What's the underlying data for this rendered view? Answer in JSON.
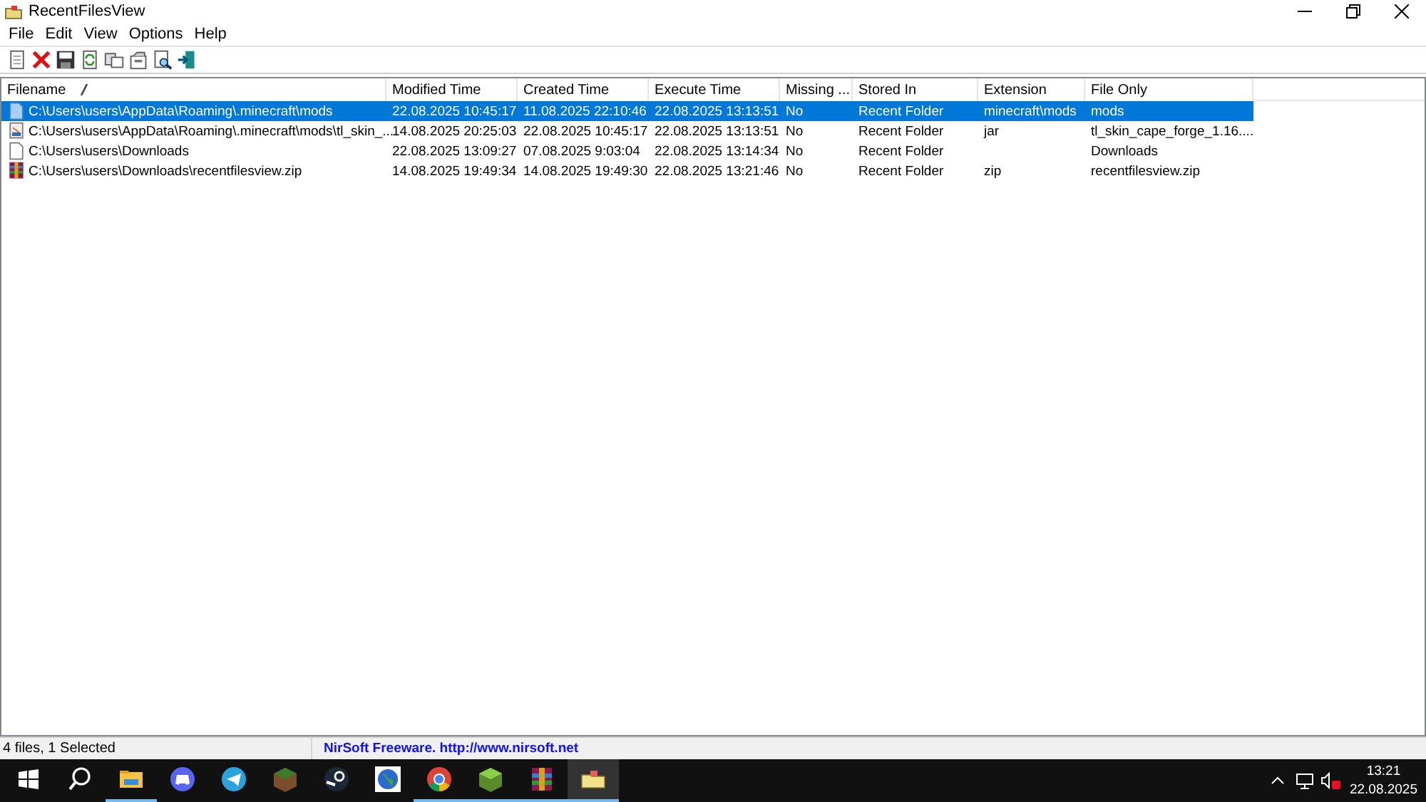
{
  "window": {
    "title": "RecentFilesView"
  },
  "menu": [
    "File",
    "Edit",
    "View",
    "Options",
    "Help"
  ],
  "table": {
    "columns": [
      {
        "label": "Filename",
        "sorted": true
      },
      {
        "label": "Modified Time",
        "sorted": false
      },
      {
        "label": "Created Time",
        "sorted": false
      },
      {
        "label": "Execute Time",
        "sorted": false
      },
      {
        "label": "Missing ...",
        "sorted": false
      },
      {
        "label": "Stored In",
        "sorted": false
      },
      {
        "label": "Extension",
        "sorted": false
      },
      {
        "label": "File Only",
        "sorted": false
      }
    ],
    "rows": [
      {
        "kind": "folder",
        "selected": true,
        "cells": [
          "C:\\Users\\users\\AppData\\Roaming\\.minecraft\\mods",
          "22.08.2025 10:45:17",
          "11.08.2025 22:10:46",
          "22.08.2025 13:13:51",
          "No",
          "Recent Folder",
          "minecraft\\mods",
          "mods"
        ]
      },
      {
        "kind": "jar",
        "selected": false,
        "cells": [
          "C:\\Users\\users\\AppData\\Roaming\\.minecraft\\mods\\tl_skin_...",
          "14.08.2025 20:25:03",
          "22.08.2025 10:45:17",
          "22.08.2025 13:13:51",
          "No",
          "Recent Folder",
          "jar",
          "tl_skin_cape_forge_1.16...."
        ]
      },
      {
        "kind": "file",
        "selected": false,
        "cells": [
          "C:\\Users\\users\\Downloads",
          "22.08.2025 13:09:27",
          "07.08.2025 9:03:04",
          "22.08.2025 13:14:34",
          "No",
          "Recent Folder",
          "",
          "Downloads"
        ]
      },
      {
        "kind": "archive",
        "selected": false,
        "cells": [
          "C:\\Users\\users\\Downloads\\recentfilesview.zip",
          "14.08.2025 19:49:34",
          "14.08.2025 19:49:30",
          "22.08.2025 13:21:46",
          "No",
          "Recent Folder",
          "zip",
          "recentfilesview.zip"
        ]
      }
    ]
  },
  "status_bar": {
    "summary": "4 files, 1 Selected",
    "credit": "NirSoft Freeware.  http://www.nirsoft.net"
  },
  "taskbar": {
    "apps": [
      {
        "kind": "explorer",
        "running": true,
        "active": false
      },
      {
        "kind": "discord",
        "running": false,
        "active": false
      },
      {
        "kind": "telegram",
        "running": false,
        "active": false
      },
      {
        "kind": "dirt",
        "running": false,
        "active": false
      },
      {
        "kind": "steam",
        "running": false,
        "active": false
      },
      {
        "kind": "globe",
        "running": false,
        "active": false
      },
      {
        "kind": "chrome",
        "running": true,
        "active": false
      },
      {
        "kind": "grass",
        "running": true,
        "active": false
      },
      {
        "kind": "winrar",
        "running": true,
        "active": false
      },
      {
        "kind": "appfolder",
        "running": true,
        "active": true
      }
    ],
    "time": "13:21",
    "date": "22.08.2025"
  }
}
